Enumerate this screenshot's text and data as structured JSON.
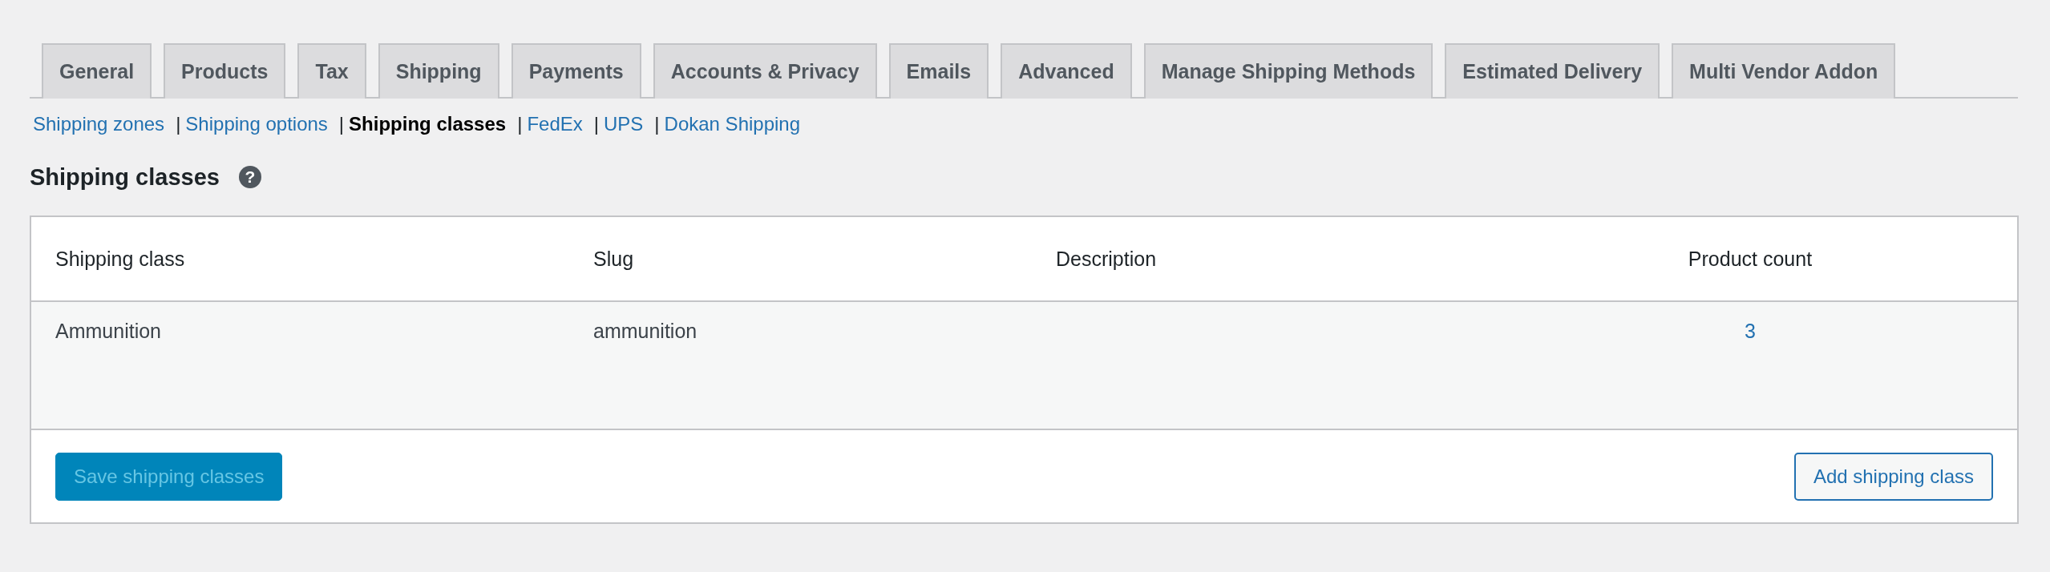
{
  "tabs": [
    {
      "label": "General",
      "selected": false
    },
    {
      "label": "Products",
      "selected": false
    },
    {
      "label": "Tax",
      "selected": false
    },
    {
      "label": "Shipping",
      "selected": false
    },
    {
      "label": "Payments",
      "selected": false
    },
    {
      "label": "Accounts & Privacy",
      "selected": false
    },
    {
      "label": "Emails",
      "selected": false
    },
    {
      "label": "Advanced",
      "selected": false
    },
    {
      "label": "Manage Shipping Methods",
      "selected": false
    },
    {
      "label": "Estimated Delivery",
      "selected": false
    },
    {
      "label": "Multi Vendor Addon",
      "selected": false
    }
  ],
  "subnav": [
    {
      "label": "Shipping zones",
      "selected": false
    },
    {
      "separator": "|",
      "label": "Shipping options",
      "selected": false
    },
    {
      "separator": "|",
      "label": "Shipping classes",
      "selected": true
    },
    {
      "separator": "|",
      "label": "FedEx",
      "selected": false
    },
    {
      "separator": "|",
      "label": "UPS",
      "selected": false
    },
    {
      "separator": "|",
      "label": "Dokan Shipping",
      "selected": false
    }
  ],
  "heading": {
    "title": "Shipping classes",
    "help_icon": "?"
  },
  "table": {
    "columns": [
      "Shipping class",
      "Slug",
      "Description",
      "Product count"
    ],
    "rows": [
      {
        "shipping_class": "Ammunition",
        "slug": "ammunition",
        "product_count": "3"
      }
    ]
  },
  "buttons": [
    {
      "label": "Save shipping classes",
      "kind": "primary",
      "disabled": true
    },
    {
      "label": "Add shipping class",
      "kind": "secondary",
      "disabled": false
    }
  ]
}
